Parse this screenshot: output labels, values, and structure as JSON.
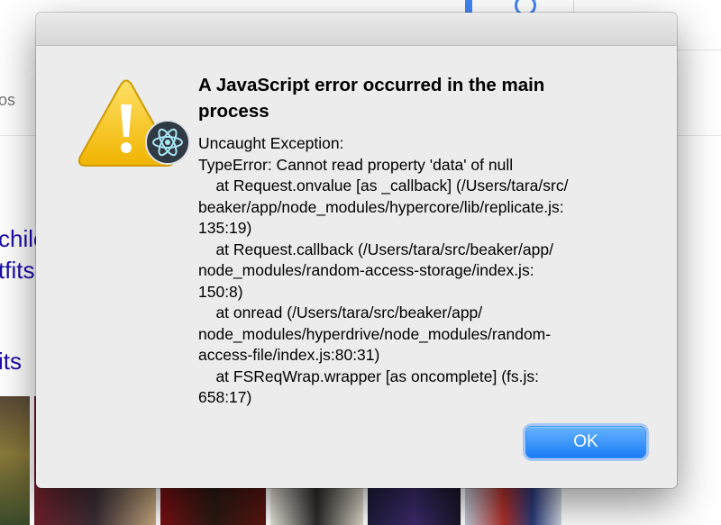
{
  "background": {
    "fragments": [
      "os",
      "chilc",
      "tfits",
      "its"
    ]
  },
  "dialog": {
    "title": "A JavaScript error occurred in the main process",
    "message": "Uncaught Exception:\nTypeError: Cannot read property 'data' of null\n    at Request.onvalue [as _callback] (/Users/tara/src/\nbeaker/app/node_modules/hypercore/lib/replicate.js:\n135:19)\n    at Request.callback (/Users/tara/src/beaker/app/\nnode_modules/random-access-storage/index.js:\n150:8)\n    at onread (/Users/tara/src/beaker/app/\nnode_modules/hyperdrive/node_modules/random-\naccess-file/index.js:80:31)\n    at FSReqWrap.wrapper [as oncomplete] (fs.js:\n658:17)",
    "ok_label": "OK",
    "icon": "warning-triangle-electron-icon",
    "accent_color": "#1a7cf5"
  }
}
